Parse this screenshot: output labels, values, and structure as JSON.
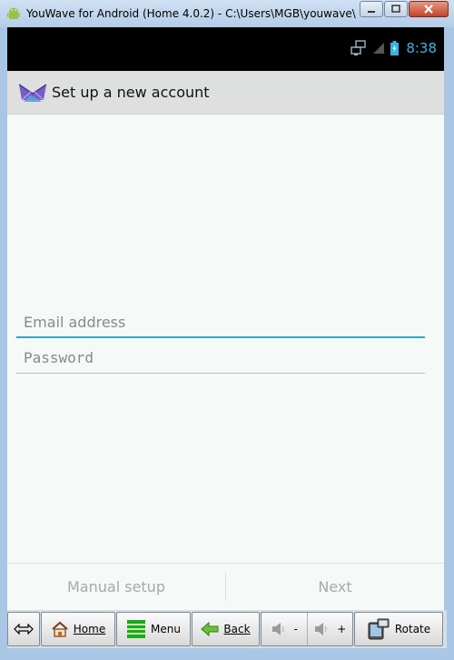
{
  "window": {
    "title": "YouWave for Android (Home 4.0.2) - C:\\Users\\MGB\\youwave\\"
  },
  "statusbar": {
    "time": "8:38"
  },
  "actionbar": {
    "title": "Set up a new account"
  },
  "form": {
    "email_placeholder": "Email address",
    "email_value": "",
    "password_placeholder": "Password",
    "password_value": ""
  },
  "buttons": {
    "manual_setup": "Manual setup",
    "next": "Next"
  },
  "toolbar": {
    "home": "Home",
    "menu": "Menu",
    "back": "Back",
    "vol_down": "-",
    "vol_up": "+",
    "rotate": "Rotate"
  },
  "colors": {
    "accent": "#33b5e5",
    "screen_bg": "#f5f9f7",
    "actionbar_bg": "#dde0df"
  }
}
